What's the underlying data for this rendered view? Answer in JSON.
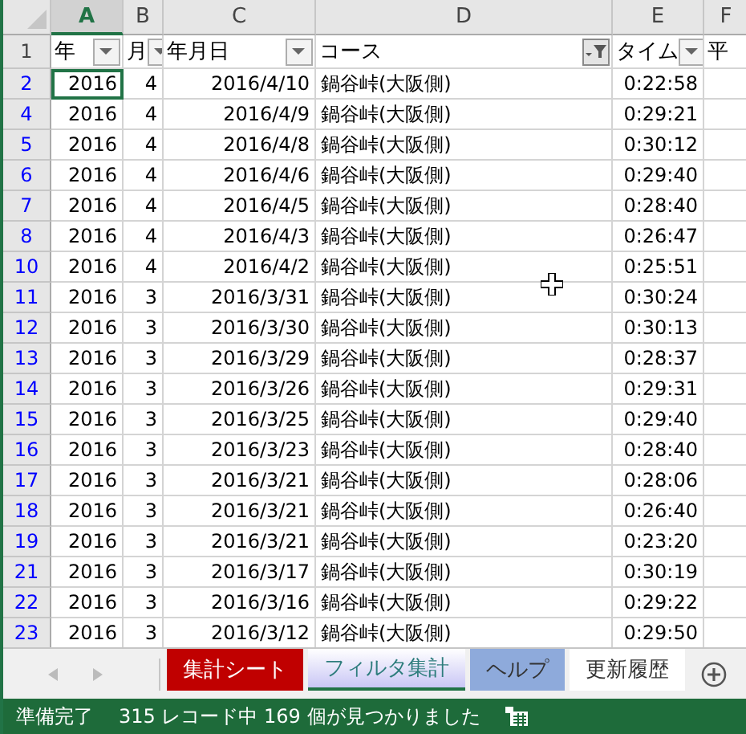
{
  "columns": [
    {
      "letter": "A",
      "selected": true
    },
    {
      "letter": "B",
      "selected": false
    },
    {
      "letter": "C",
      "selected": false
    },
    {
      "letter": "D",
      "selected": false
    },
    {
      "letter": "E",
      "selected": false
    },
    {
      "letter": "F",
      "selected": false
    }
  ],
  "header_row": {
    "number": "1",
    "cells": [
      {
        "text": "年",
        "filter_applied": false
      },
      {
        "text": "月",
        "filter_applied": false
      },
      {
        "text": "年月日",
        "filter_applied": false
      },
      {
        "text": "コース",
        "filter_applied": true
      },
      {
        "text": "タイム",
        "filter_applied": false
      },
      {
        "text": "平"
      }
    ]
  },
  "rows": [
    {
      "number": "2",
      "filtered": true,
      "cells": [
        {
          "text": "2016",
          "selected": true
        },
        {
          "text": "4",
          "selected": false
        },
        {
          "text": "2016/4/10",
          "selected": false
        },
        {
          "text": "鍋谷峠(大阪側)",
          "selected": false
        },
        {
          "text": "0:22:58",
          "selected": false
        }
      ]
    },
    {
      "number": "4",
      "filtered": true,
      "cells": [
        {
          "text": "2016",
          "selected": false
        },
        {
          "text": "4",
          "selected": false
        },
        {
          "text": "2016/4/9",
          "selected": false
        },
        {
          "text": "鍋谷峠(大阪側)",
          "selected": false
        },
        {
          "text": "0:29:21",
          "selected": false
        }
      ]
    },
    {
      "number": "5",
      "filtered": true,
      "cells": [
        {
          "text": "2016",
          "selected": false
        },
        {
          "text": "4",
          "selected": false
        },
        {
          "text": "2016/4/8",
          "selected": false
        },
        {
          "text": "鍋谷峠(大阪側)",
          "selected": false
        },
        {
          "text": "0:30:12",
          "selected": false
        }
      ]
    },
    {
      "number": "6",
      "filtered": true,
      "cells": [
        {
          "text": "2016",
          "selected": false
        },
        {
          "text": "4",
          "selected": false
        },
        {
          "text": "2016/4/6",
          "selected": false
        },
        {
          "text": "鍋谷峠(大阪側)",
          "selected": false
        },
        {
          "text": "0:29:40",
          "selected": false
        }
      ]
    },
    {
      "number": "7",
      "filtered": true,
      "cells": [
        {
          "text": "2016",
          "selected": false
        },
        {
          "text": "4",
          "selected": false
        },
        {
          "text": "2016/4/5",
          "selected": false
        },
        {
          "text": "鍋谷峠(大阪側)",
          "selected": false
        },
        {
          "text": "0:28:40",
          "selected": false
        }
      ]
    },
    {
      "number": "8",
      "filtered": true,
      "cells": [
        {
          "text": "2016",
          "selected": false
        },
        {
          "text": "4",
          "selected": false
        },
        {
          "text": "2016/4/3",
          "selected": false
        },
        {
          "text": "鍋谷峠(大阪側)",
          "selected": false
        },
        {
          "text": "0:26:47",
          "selected": false
        }
      ]
    },
    {
      "number": "10",
      "filtered": true,
      "cells": [
        {
          "text": "2016",
          "selected": false
        },
        {
          "text": "4",
          "selected": false
        },
        {
          "text": "2016/4/2",
          "selected": false
        },
        {
          "text": "鍋谷峠(大阪側)",
          "selected": false
        },
        {
          "text": "0:25:51",
          "selected": false
        }
      ]
    },
    {
      "number": "11",
      "filtered": true,
      "cells": [
        {
          "text": "2016",
          "selected": false
        },
        {
          "text": "3",
          "selected": false
        },
        {
          "text": "2016/3/31",
          "selected": false
        },
        {
          "text": "鍋谷峠(大阪側)",
          "selected": false
        },
        {
          "text": "0:30:24",
          "selected": false
        }
      ]
    },
    {
      "number": "12",
      "filtered": true,
      "cells": [
        {
          "text": "2016",
          "selected": false
        },
        {
          "text": "3",
          "selected": false
        },
        {
          "text": "2016/3/30",
          "selected": false
        },
        {
          "text": "鍋谷峠(大阪側)",
          "selected": false
        },
        {
          "text": "0:30:13",
          "selected": false
        }
      ]
    },
    {
      "number": "13",
      "filtered": true,
      "cells": [
        {
          "text": "2016",
          "selected": false
        },
        {
          "text": "3",
          "selected": false
        },
        {
          "text": "2016/3/29",
          "selected": false
        },
        {
          "text": "鍋谷峠(大阪側)",
          "selected": false
        },
        {
          "text": "0:28:37",
          "selected": false
        }
      ]
    },
    {
      "number": "14",
      "filtered": true,
      "cells": [
        {
          "text": "2016",
          "selected": false
        },
        {
          "text": "3",
          "selected": false
        },
        {
          "text": "2016/3/26",
          "selected": false
        },
        {
          "text": "鍋谷峠(大阪側)",
          "selected": false
        },
        {
          "text": "0:29:31",
          "selected": false
        }
      ]
    },
    {
      "number": "15",
      "filtered": true,
      "cells": [
        {
          "text": "2016",
          "selected": false
        },
        {
          "text": "3",
          "selected": false
        },
        {
          "text": "2016/3/25",
          "selected": false
        },
        {
          "text": "鍋谷峠(大阪側)",
          "selected": false
        },
        {
          "text": "0:29:40",
          "selected": false
        }
      ]
    },
    {
      "number": "16",
      "filtered": true,
      "cells": [
        {
          "text": "2016",
          "selected": false
        },
        {
          "text": "3",
          "selected": false
        },
        {
          "text": "2016/3/23",
          "selected": false
        },
        {
          "text": "鍋谷峠(大阪側)",
          "selected": false
        },
        {
          "text": "0:28:40",
          "selected": false
        }
      ]
    },
    {
      "number": "17",
      "filtered": true,
      "cells": [
        {
          "text": "2016",
          "selected": false
        },
        {
          "text": "3",
          "selected": false
        },
        {
          "text": "2016/3/21",
          "selected": false
        },
        {
          "text": "鍋谷峠(大阪側)",
          "selected": false
        },
        {
          "text": "0:28:06",
          "selected": false
        }
      ]
    },
    {
      "number": "18",
      "filtered": true,
      "cells": [
        {
          "text": "2016",
          "selected": false
        },
        {
          "text": "3",
          "selected": false
        },
        {
          "text": "2016/3/21",
          "selected": false
        },
        {
          "text": "鍋谷峠(大阪側)",
          "selected": false
        },
        {
          "text": "0:26:40",
          "selected": false
        }
      ]
    },
    {
      "number": "19",
      "filtered": true,
      "cells": [
        {
          "text": "2016",
          "selected": false
        },
        {
          "text": "3",
          "selected": false
        },
        {
          "text": "2016/3/21",
          "selected": false
        },
        {
          "text": "鍋谷峠(大阪側)",
          "selected": false
        },
        {
          "text": "0:23:20",
          "selected": false
        }
      ]
    },
    {
      "number": "21",
      "filtered": true,
      "cells": [
        {
          "text": "2016",
          "selected": false
        },
        {
          "text": "3",
          "selected": false
        },
        {
          "text": "2016/3/17",
          "selected": false
        },
        {
          "text": "鍋谷峠(大阪側)",
          "selected": false
        },
        {
          "text": "0:30:19",
          "selected": false
        }
      ]
    },
    {
      "number": "22",
      "filtered": true,
      "cells": [
        {
          "text": "2016",
          "selected": false
        },
        {
          "text": "3",
          "selected": false
        },
        {
          "text": "2016/3/16",
          "selected": false
        },
        {
          "text": "鍋谷峠(大阪側)",
          "selected": false
        },
        {
          "text": "0:29:22",
          "selected": false
        }
      ]
    },
    {
      "number": "23",
      "filtered": true,
      "cells": [
        {
          "text": "2016",
          "selected": false
        },
        {
          "text": "3",
          "selected": false
        },
        {
          "text": "2016/3/12",
          "selected": false
        },
        {
          "text": "鍋谷峠(大阪側)",
          "selected": false
        },
        {
          "text": "0:29:50",
          "selected": false
        }
      ]
    }
  ],
  "sheet_tabs": [
    {
      "label": "集計シート",
      "color": "#c00000",
      "selected": false
    },
    {
      "label": "フィルタ集計",
      "color": "#c9c6f5",
      "selected": true
    },
    {
      "label": "ヘルプ",
      "color": "#8eaadb",
      "selected": false
    },
    {
      "label": "更新履歴",
      "color": "#ffffff",
      "selected": false
    }
  ],
  "status_bar": {
    "state": "準備完了",
    "message": "315 レコード中 169 個が見つかりました"
  }
}
